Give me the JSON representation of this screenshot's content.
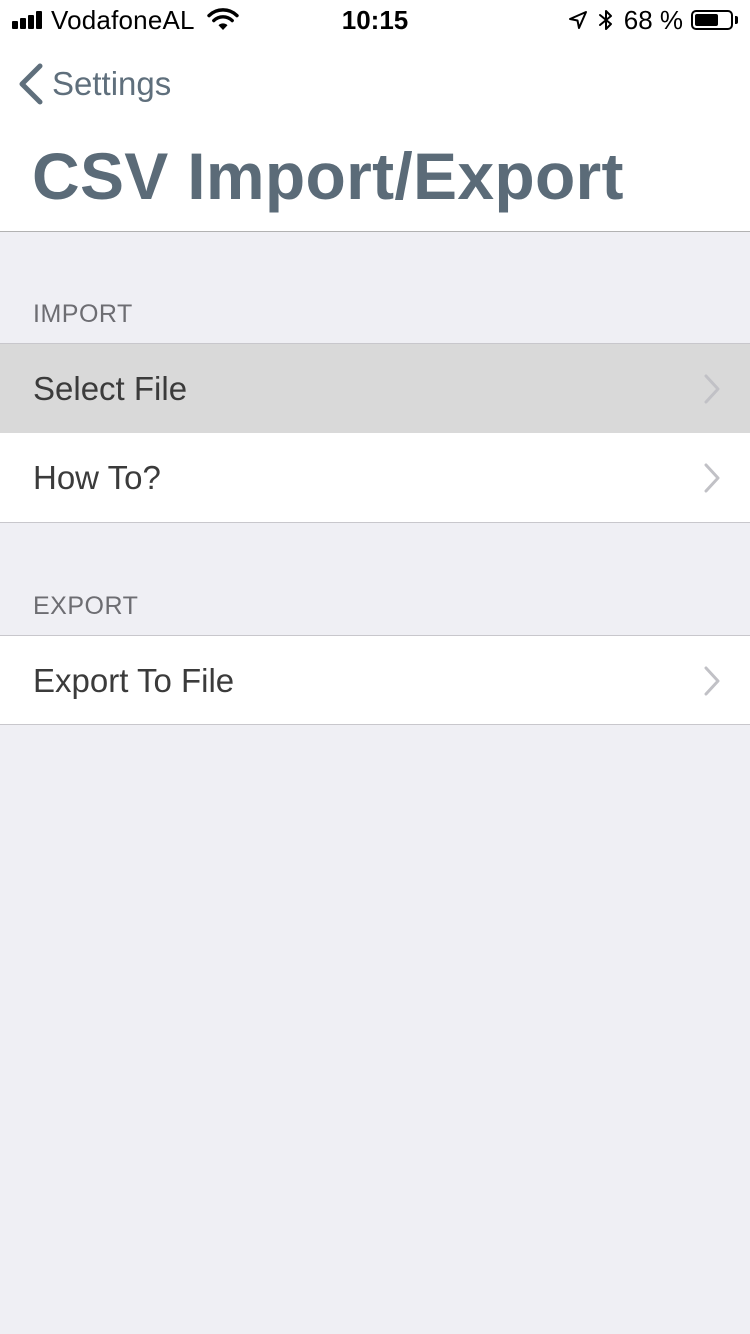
{
  "status_bar": {
    "carrier": "VodafoneAL",
    "time": "10:15",
    "battery_percent_text": "68 %",
    "battery_level": 0.68,
    "signal_bars": 4,
    "icons": [
      "signal-icon",
      "wifi-icon",
      "location-arrow-icon",
      "bluetooth-icon",
      "battery-icon"
    ]
  },
  "nav": {
    "back_label": "Settings",
    "title": "CSV Import/Export",
    "accent_color": "#5b6b78"
  },
  "sections": [
    {
      "header": "IMPORT",
      "rows": [
        {
          "label": "Select File",
          "highlighted": true
        },
        {
          "label": "How To?",
          "highlighted": false
        }
      ]
    },
    {
      "header": "EXPORT",
      "rows": [
        {
          "label": "Export To File",
          "highlighted": false
        }
      ]
    }
  ]
}
